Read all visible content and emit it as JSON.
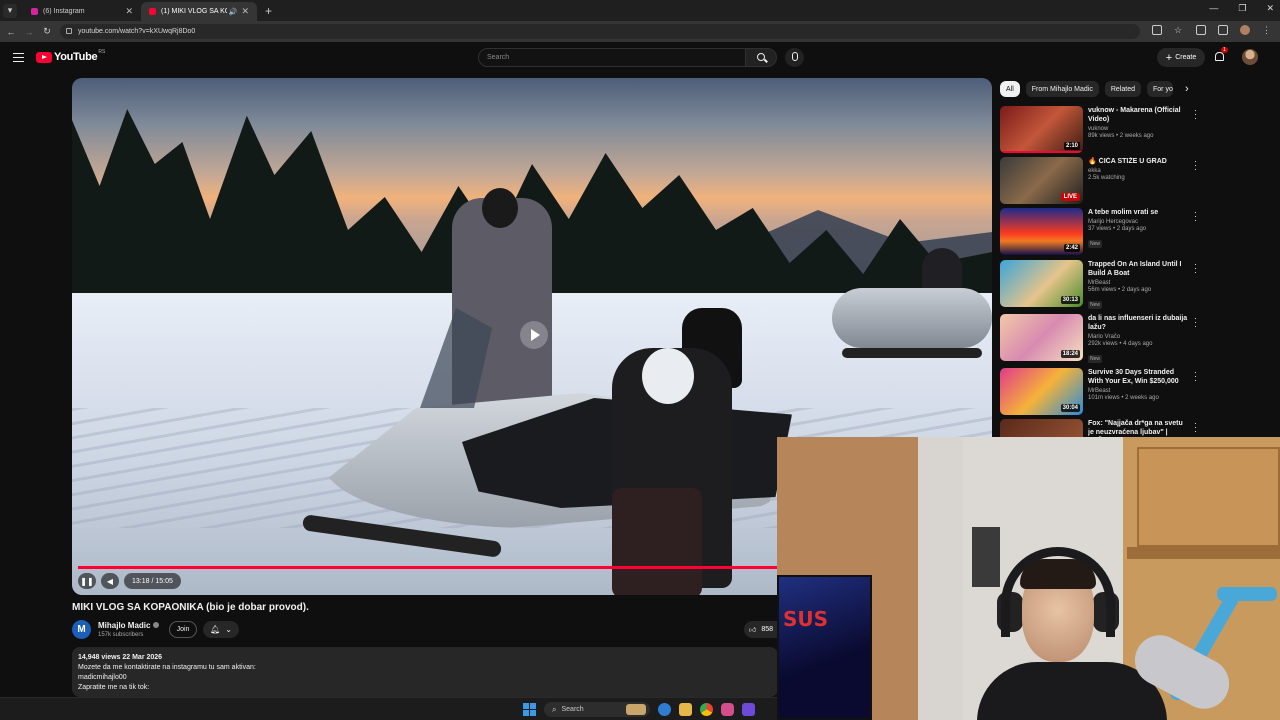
{
  "browser": {
    "tabs": [
      {
        "title": "(6) Instagram",
        "favicon_color": "#d6249f"
      },
      {
        "title": "(1) MIKI VLOG SA KOPAON...",
        "favicon_color": "#ff0033",
        "active": true
      }
    ],
    "url": "youtube.com/watch?v=kXUwqRj8Do0"
  },
  "header": {
    "logo": "YouTube",
    "region": "RS",
    "search_placeholder": "Search",
    "create_label": "Create",
    "notification_count": "1"
  },
  "player": {
    "time_display": "13:18 / 15:05",
    "progress_fraction": 0.881
  },
  "video": {
    "title": "MIKI VLOG SA KOPAONIKA (bio je dobar provod).",
    "channel_initial": "M",
    "channel_name": "Mihajlo Madic",
    "subscribers": "157k subscribers",
    "join_label": "Join",
    "likes": "858",
    "views_date": "14,948 views  22 Mar 2026",
    "description_lines": [
      "Mozete da me kontaktirate na instagramu tu sam aktivan:",
      "madicmihajlo00",
      "Zapratite me na tik tok:"
    ]
  },
  "sidebar": {
    "chips": [
      "All",
      "From Mihajlo Madic",
      "Related",
      "For you"
    ],
    "recommendations": [
      {
        "title": "vuknow - Makarena (Official Video)",
        "channel": "vuknow",
        "meta": "89k views • 2 weeks ago",
        "duration": "2:10",
        "thumb": "linear-gradient(135deg,#7a1a1a,#c2573a 50%,#3b1c12)",
        "watched": true
      },
      {
        "title": "🔥 ČIČA STIŽE U GRAD",
        "channel": "ekka",
        "meta": "2.5k watching",
        "live": "LIVE",
        "thumb": "linear-gradient(135deg,#3a3a3a,#8a6a4a 50%,#202020)"
      },
      {
        "title": "A tebe molim vrati se",
        "channel": "Marijo Hercegovac",
        "meta": "37 views • 2 days ago",
        "badge": "New",
        "duration": "2:42",
        "thumb": "linear-gradient(180deg,#1e2a8a,#ff3b1f 55%,#f07a22 70%,#13104a)"
      },
      {
        "title": "Trapped On An Island Until I Build A Boat",
        "channel": "MrBeast",
        "meta": "56m views • 2 days ago",
        "badge": "New",
        "duration": "30:13",
        "thumb": "linear-gradient(135deg,#3aa5d8,#e4c48b 55%,#4a8a2a)"
      },
      {
        "title": "da li nas influenseri iz dubaija lažu?",
        "channel": "Mario Vračo",
        "meta": "292k views • 4 days ago",
        "badge": "New",
        "duration": "18:24",
        "thumb": "linear-gradient(135deg,#f2c9a8,#d88ab0 50%,#f5e0c0)"
      },
      {
        "title": "Survive 30 Days Stranded With Your Ex, Win $250,000",
        "channel": "MrBeast",
        "meta": "101m views • 2 weeks ago",
        "duration": "30:04",
        "thumb": "linear-gradient(135deg,#e03a8a,#f5b33a 50%,#2a8ad8)"
      },
      {
        "title": "Fox: \"Najjača dr*ga na svetu je neuzvraćena ljubav\" | NEŠTO ...",
        "channel": "",
        "meta": "",
        "thumb": "linear-gradient(135deg,#5a2a1a,#a05a3a)"
      }
    ]
  },
  "taskbar": {
    "search_label": "Search"
  },
  "colors": {
    "yt_red": "#ff0033",
    "background": "#0f0f0f"
  }
}
